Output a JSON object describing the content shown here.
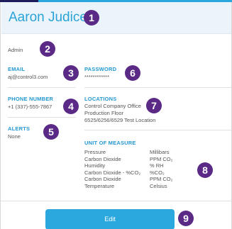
{
  "user": {
    "name": "Aaron Judice",
    "role": "Admin"
  },
  "email": {
    "label": "EMAIL",
    "value": "aj@control3.com"
  },
  "password": {
    "label": "PASSWORD",
    "value": "************"
  },
  "phone": {
    "label": "PHONE NUMBER",
    "value": "+1 (337)-555-7867"
  },
  "locations": {
    "label": "LOCATIONS",
    "lines": [
      "Control Company Office",
      "Production Floor",
      "6525/6256/6529 Test Location"
    ]
  },
  "alerts": {
    "label": "ALERTS",
    "value": "None"
  },
  "unit_of_measure": {
    "label": "UNIT OF MEASURE",
    "rows": [
      {
        "name": "Pressure",
        "unit": "Millibars"
      },
      {
        "name": "Carbon Dioxide",
        "unit": "PPM CO₂"
      },
      {
        "name": "Humidity",
        "unit": "% RH"
      },
      {
        "name": "Carbon Dioxide - %CO₂",
        "unit": "%CO₂"
      },
      {
        "name": "Carbon Dioxide",
        "unit": "PPM CO₂"
      },
      {
        "name": "Temperature",
        "unit": "Celsius"
      }
    ]
  },
  "actions": {
    "edit_label": "Edit"
  },
  "badges": [
    "1",
    "2",
    "3",
    "4",
    "5",
    "6",
    "7",
    "8",
    "9"
  ],
  "colors": {
    "accent": "#2ba8de",
    "badge": "#5a2a86",
    "header_bg": "#eaf4fa"
  }
}
